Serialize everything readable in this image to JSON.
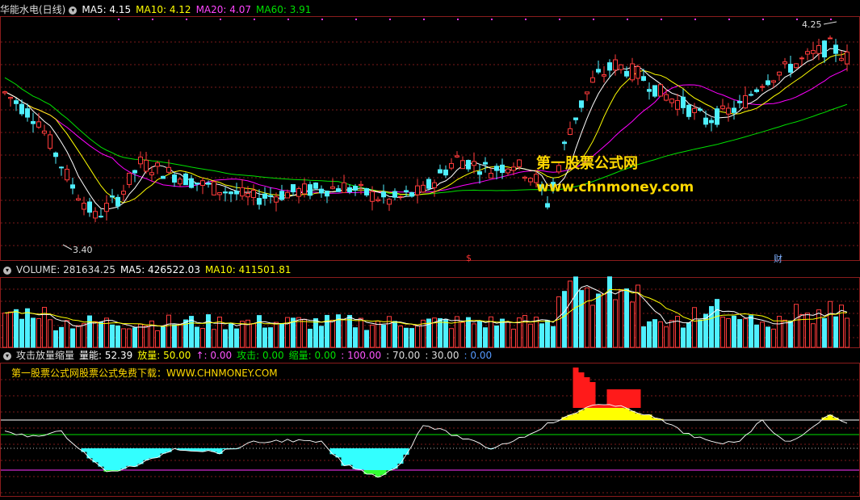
{
  "price_header": {
    "name": "华能水电(日线)",
    "ma5": "MA5: 4.15",
    "ma10": "MA10: 4.12",
    "ma20": "MA20: 4.07",
    "ma60": "MA60: 3.91"
  },
  "volume_header": {
    "label": "VOLUME: 281634.25",
    "ma5": "MA5: 426522.03",
    "ma10": "MA10: 411501.81"
  },
  "indicator_header": {
    "name": "攻击放量缩量",
    "liangneng": "量能: 52.39",
    "fangliang": "放量: 50.00",
    "up": "↑: 0.00",
    "gongji": "攻击: 0.00",
    "suoliang": "缩量: 0.00",
    "l100": ": 100.00",
    "l70": ": 70.00",
    "l30": ": 30.00",
    "l0": ": 0.00"
  },
  "watermark": {
    "line1": "第一股票公式网",
    "line2": "www.chnmoney.com"
  },
  "promo_text": "第一股票公式网股票公式免费下载：WWW.CHNMONEY.COM",
  "markers": {
    "dollar": "$",
    "cai": "财"
  },
  "colors": {
    "up": "#ff3b3b",
    "down": "#4ff0ff",
    "ma5": "#ffffff",
    "ma10": "#ffff00",
    "ma20": "#ff00ff",
    "ma60": "#00e000",
    "bar_red": "#ff1a1a",
    "bar_yellow": "#ffff00",
    "bar_cyan": "#33ffff",
    "bar_green": "#33ff33",
    "grid": "#7a1a1a"
  },
  "chart_data": [
    {
      "type": "candlestick",
      "title": "华能水电(日线)",
      "ylim": [
        3.3,
        4.32
      ],
      "annotations": {
        "low": "3.40",
        "high": "4.25"
      },
      "series_names": [
        "MA5",
        "MA10",
        "MA20",
        "MA60"
      ]
    },
    {
      "type": "bar",
      "title": "VOLUME",
      "series_names": [
        "VOLUME",
        "MA5",
        "MA10"
      ]
    },
    {
      "type": "area",
      "title": "攻击放量缩量",
      "ylim": [
        0,
        100
      ],
      "levels": [
        0,
        30,
        50,
        70,
        100
      ]
    }
  ]
}
